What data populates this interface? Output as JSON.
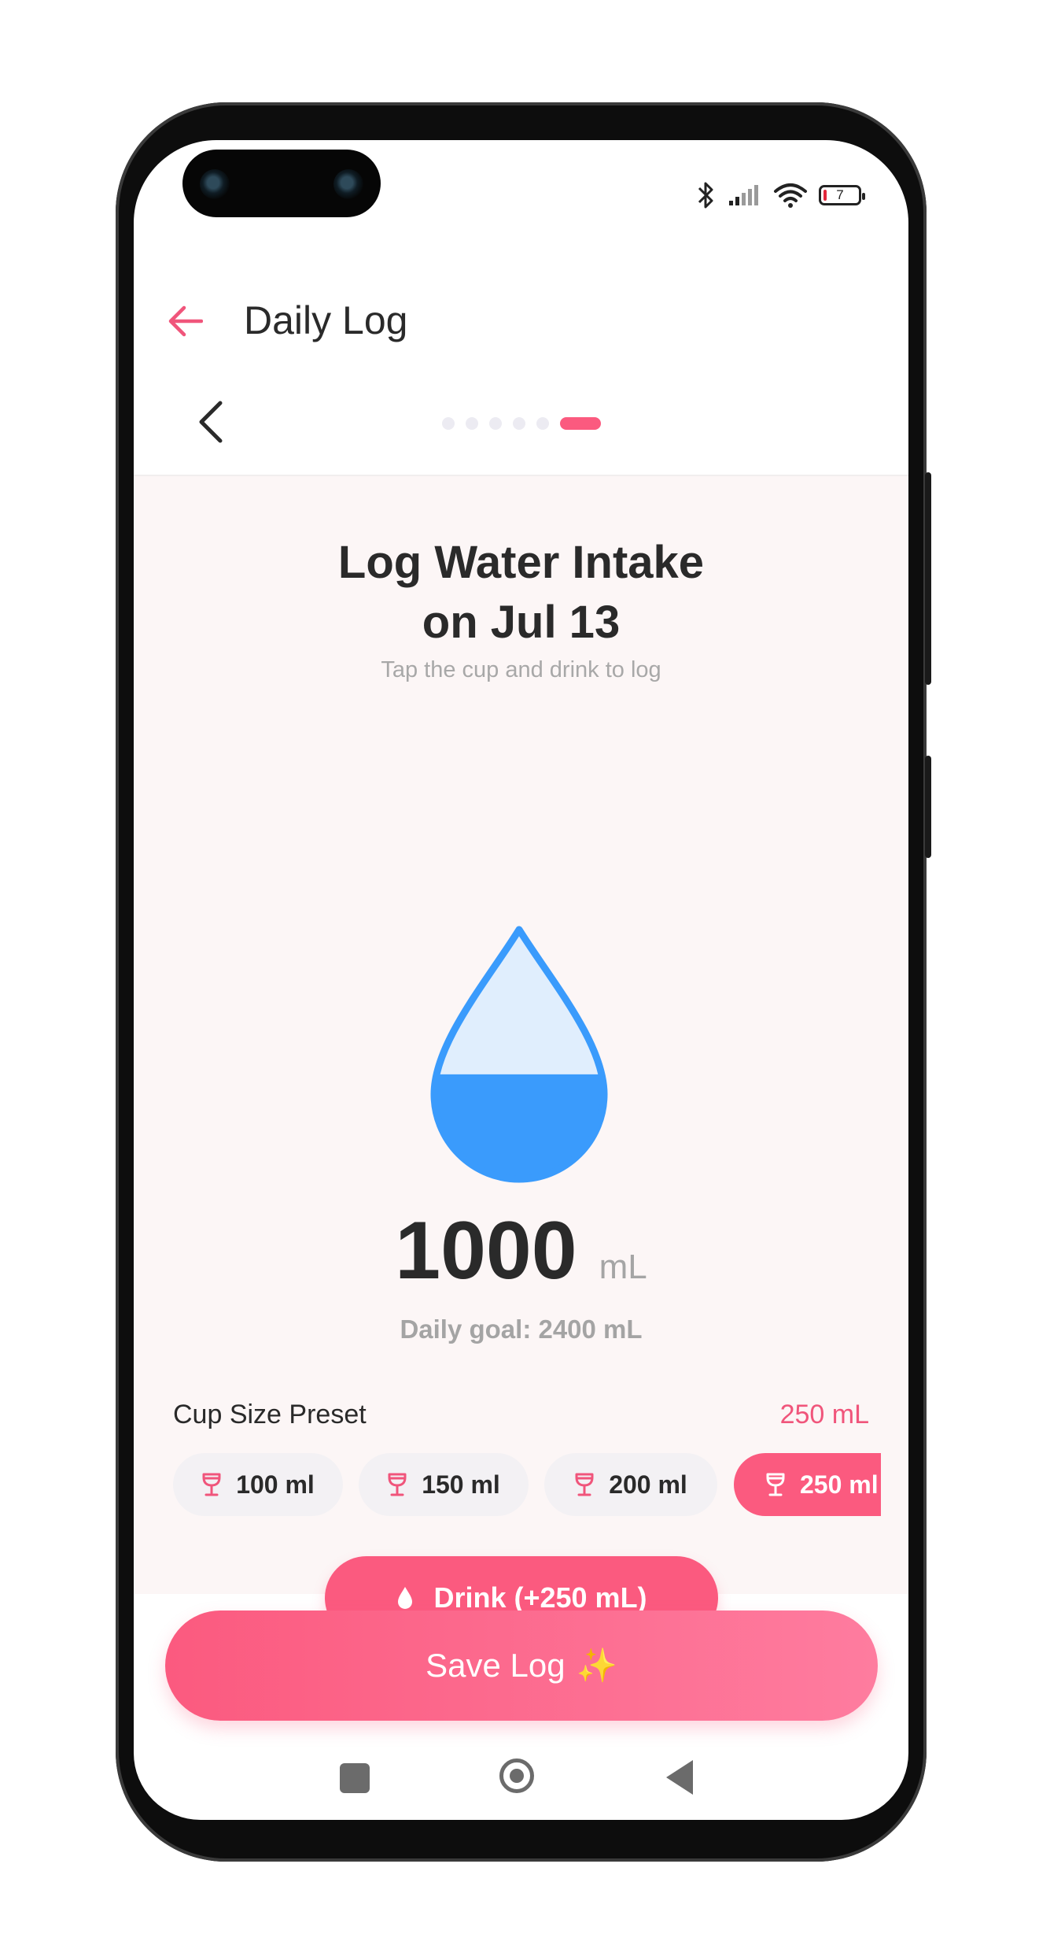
{
  "status_bar": {
    "battery_level": "7"
  },
  "app_bar": {
    "title": "Daily Log"
  },
  "stepper": {
    "total_steps": 6,
    "current_step": 6
  },
  "main": {
    "title_line1": "Log Water Intake",
    "title_line2": "on Jul 13",
    "subtitle": "Tap the cup and drink to log",
    "fill_fraction": 0.42,
    "amount_value": "1000",
    "amount_unit": "mL",
    "goal_text": "Daily goal: 2400 mL"
  },
  "cup_preset": {
    "label": "Cup Size Preset",
    "selected_value": "250 mL",
    "options": [
      {
        "label": "100 ml"
      },
      {
        "label": "150 ml"
      },
      {
        "label": "200 ml"
      },
      {
        "label": "250 ml"
      }
    ]
  },
  "actions": {
    "drink_label": "Drink (+250 mL)",
    "save_label": "Save Log",
    "save_emoji": "✨"
  },
  "colors": {
    "accent": "#fb5a7f",
    "water": "#3a9bfc",
    "water_light": "#e0eefd"
  }
}
